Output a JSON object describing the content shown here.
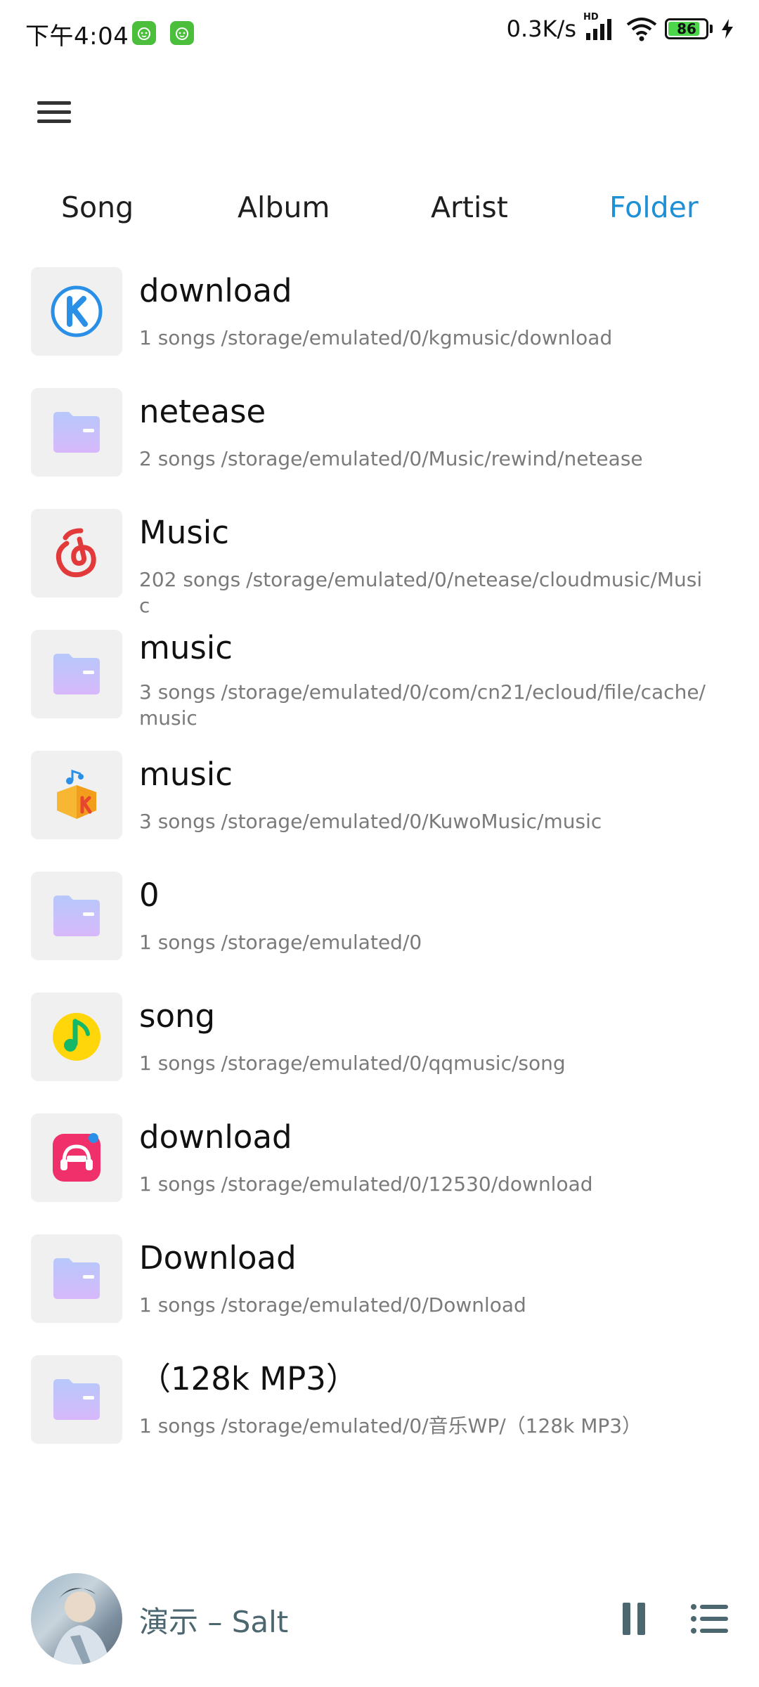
{
  "status_bar": {
    "time": "下午4:04",
    "network_speed": "0.3K/s",
    "network_badge": "HD",
    "battery_percent": "86",
    "battery_level": 0.86,
    "app_icons": [
      "green-app-icon",
      "green-app-icon"
    ]
  },
  "menu": {
    "icon": "hamburger-menu-icon"
  },
  "tabs": [
    {
      "label": "Song",
      "active": false
    },
    {
      "label": "Album",
      "active": false
    },
    {
      "label": "Artist",
      "active": false
    },
    {
      "label": "Folder",
      "active": true
    }
  ],
  "folders": [
    {
      "name": "download",
      "count": "1 songs",
      "path": "/storage/emulated/0/kgmusic/download",
      "icon": "kugou-icon"
    },
    {
      "name": "netease",
      "count": "2 songs",
      "path": "/storage/emulated/0/Music/rewind/netease",
      "icon": "folder-icon"
    },
    {
      "name": "Music",
      "count": "202 songs",
      "path": "/storage/emulated/0/netease/cloudmusic/Music",
      "icon": "netease-music-icon"
    },
    {
      "name": "music",
      "count": "3 songs",
      "path": "/storage/emulated/0/com/cn21/ecloud/file/cache/music",
      "icon": "folder-icon"
    },
    {
      "name": "music",
      "count": "3 songs",
      "path": "/storage/emulated/0/KuwoMusic/music",
      "icon": "kuwo-icon"
    },
    {
      "name": "0",
      "count": "1 songs",
      "path": "/storage/emulated/0",
      "icon": "folder-icon"
    },
    {
      "name": "song",
      "count": "1 songs",
      "path": "/storage/emulated/0/qqmusic/song",
      "icon": "qq-music-icon"
    },
    {
      "name": "download",
      "count": "1 songs",
      "path": "/storage/emulated/0/12530/download",
      "icon": "migu-music-icon"
    },
    {
      "name": "Download",
      "count": "1 songs",
      "path": "/storage/emulated/0/Download",
      "icon": "folder-icon"
    },
    {
      "name": "（128k MP3）",
      "count": "1 songs",
      "path": "/storage/emulated/0/音乐WP/（128k MP3）",
      "icon": "folder-icon"
    }
  ],
  "player": {
    "title": "演示 – Salt",
    "pause_icon": "pause-icon",
    "queue_icon": "queue-list-icon"
  },
  "colors": {
    "accent": "#1e90d6",
    "text": "#111111",
    "secondary_text": "#7a7a7a",
    "thumb_bg": "#f0f0f0",
    "player_text": "#4c6770"
  }
}
